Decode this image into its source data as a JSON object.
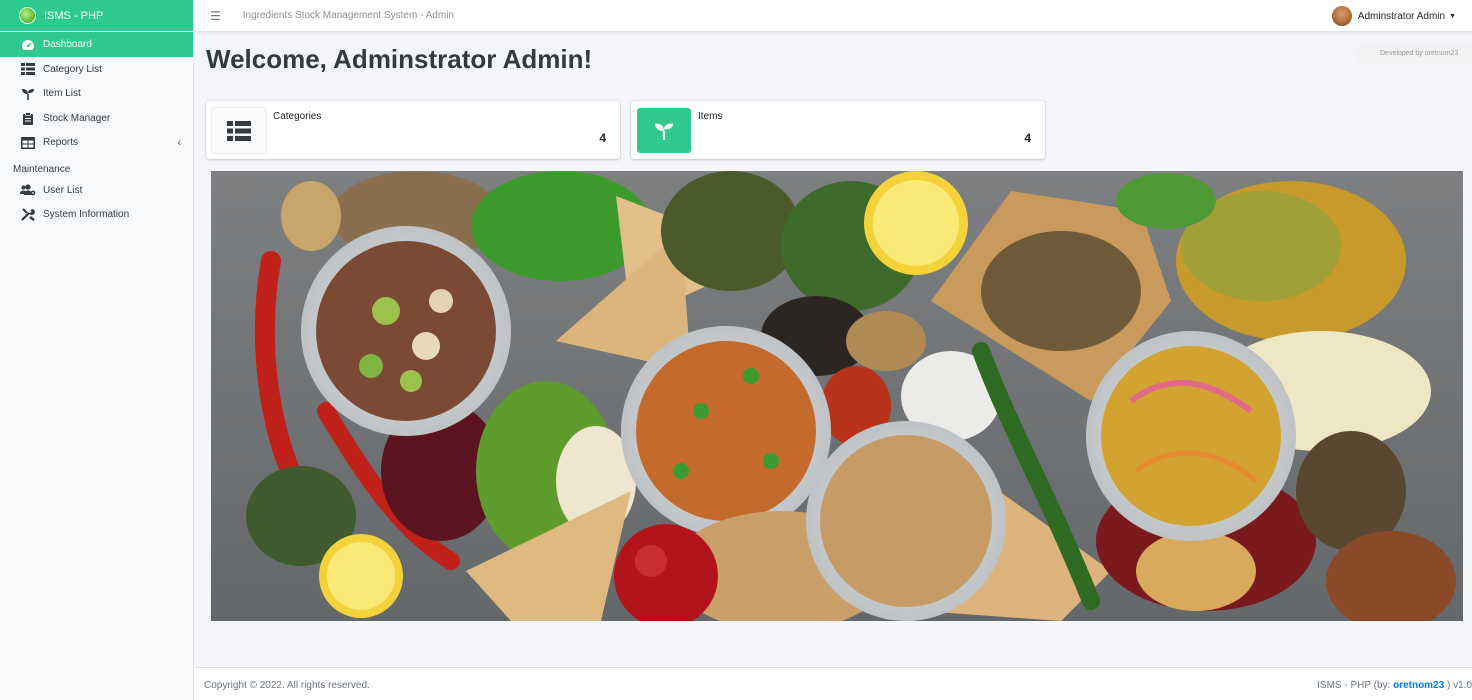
{
  "brand": {
    "name": "ISMS - PHP"
  },
  "sidebar": {
    "items": [
      {
        "label": "Dashboard",
        "icon": "tachometer-icon"
      },
      {
        "label": "Category List",
        "icon": "th-list-icon"
      },
      {
        "label": "Item List",
        "icon": "seedling-icon"
      },
      {
        "label": "Stock Manager",
        "icon": "clipboard-icon"
      },
      {
        "label": "Reports",
        "icon": "table-icon"
      }
    ],
    "maintenance_header": "Maintenance",
    "maintenance_items": [
      {
        "label": "User List",
        "icon": "users-cog-icon"
      },
      {
        "label": "System Information",
        "icon": "tools-icon"
      }
    ]
  },
  "topbar": {
    "title": "Ingredients Stock Management System - Admin",
    "user_name": "Adminstrator Admin"
  },
  "dev_note": "Developed by oretnom23",
  "main": {
    "welcome": "Welcome, Adminstrator Admin!",
    "info_boxes": [
      {
        "label": "Categories",
        "value": "4",
        "icon": "th-list-icon",
        "icon_bg": "#f8f9fa"
      },
      {
        "label": "Items",
        "value": "4",
        "icon": "seedling-icon",
        "icon_bg": "#2ec98e"
      }
    ]
  },
  "footer": {
    "copyright": "Copyright © 2022. All rights reserved.",
    "version_prefix": "ISMS - PHP (by: ",
    "author": "oretnom23",
    "version_suffix": " ) v1.0"
  },
  "colors": {
    "accent": "#2ec98e",
    "link": "#007bff"
  }
}
